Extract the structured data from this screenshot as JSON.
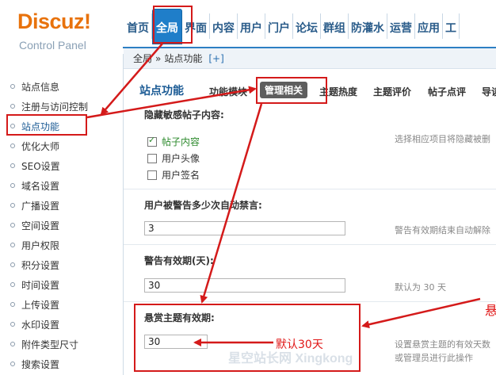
{
  "logo": {
    "name": "Discuz!",
    "subtitle": "Control Panel"
  },
  "topnav": {
    "items": [
      {
        "label": "首页"
      },
      {
        "label": "全局"
      },
      {
        "label": "界面"
      },
      {
        "label": "内容"
      },
      {
        "label": "用户"
      },
      {
        "label": "门户"
      },
      {
        "label": "论坛"
      },
      {
        "label": "群组"
      },
      {
        "label": "防灌水"
      },
      {
        "label": "运营"
      },
      {
        "label": "应用"
      },
      {
        "label": "工"
      }
    ],
    "active_index": 1,
    "accent_color": "#1f7ec9"
  },
  "breadcrumb": {
    "root": "全局",
    "sep": "»",
    "current": "站点功能",
    "add": "[+]"
  },
  "sidebar": {
    "items": [
      {
        "label": "站点信息"
      },
      {
        "label": "注册与访问控制"
      },
      {
        "label": "站点功能"
      },
      {
        "label": "优化大师"
      },
      {
        "label": "SEO设置"
      },
      {
        "label": "域名设置"
      },
      {
        "label": "广播设置"
      },
      {
        "label": "空间设置"
      },
      {
        "label": "用户权限"
      },
      {
        "label": "积分设置"
      },
      {
        "label": "时间设置"
      },
      {
        "label": "上传设置"
      },
      {
        "label": "水印设置"
      },
      {
        "label": "附件类型尺寸"
      },
      {
        "label": "搜索设置"
      }
    ],
    "active_index": 2
  },
  "subtabs": {
    "page_title": "站点功能",
    "items": [
      {
        "label": "功能模块"
      },
      {
        "label": "管理相关"
      },
      {
        "label": "主题热度"
      },
      {
        "label": "主题评价"
      },
      {
        "label": "帖子点评"
      },
      {
        "label": "导读"
      }
    ],
    "active_index": 1
  },
  "settings": {
    "hide_sensitive": {
      "label": "隐藏敏感帖子内容:",
      "hint": "选择相应项目将隐藏被删",
      "options": [
        {
          "label": "帖子内容",
          "checked": true
        },
        {
          "label": "用户头像",
          "checked": false
        },
        {
          "label": "用户签名",
          "checked": false
        }
      ]
    },
    "warn_ban": {
      "label": "用户被警告多少次自动禁言:",
      "value": "3",
      "hint": "警告有效期结束自动解除"
    },
    "warn_expiry": {
      "label": "警告有效期(天):",
      "value": "30",
      "hint": "默认为 30 天"
    },
    "reward_expiry": {
      "label": "悬赏主题有效期:",
      "value": "30",
      "hint": "设置悬赏主题的有效天数",
      "hint2": "或管理员进行此操作"
    }
  },
  "annotations": {
    "default_note": "默认30天",
    "edge_char": "悬"
  },
  "watermark": "星空站长网 Xingkong"
}
